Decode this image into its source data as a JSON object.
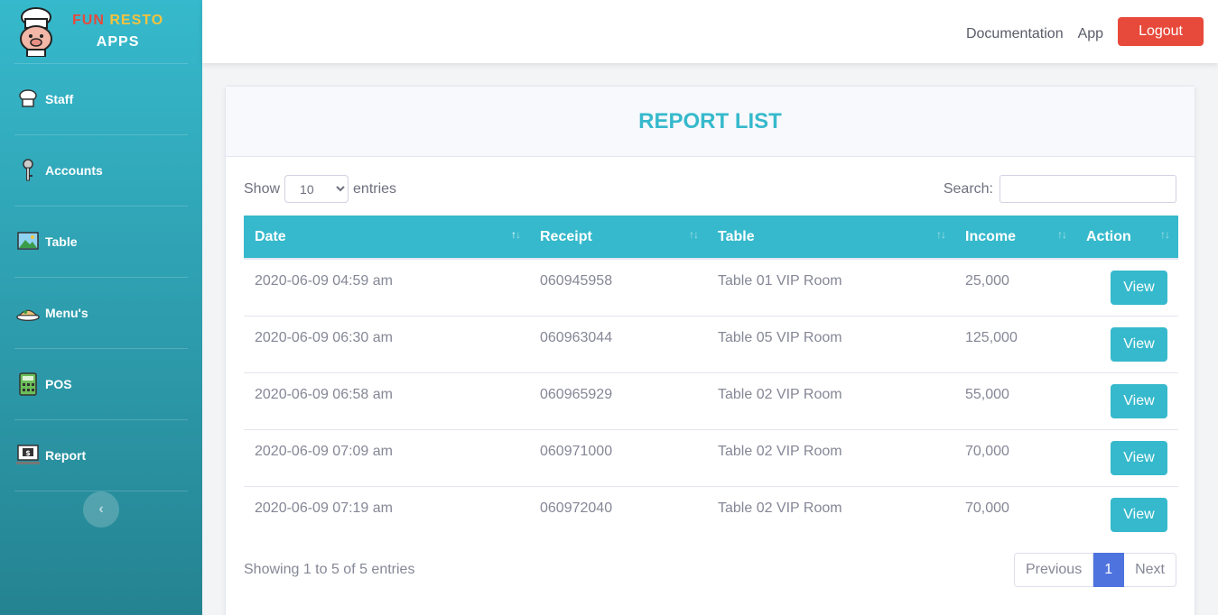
{
  "brand": {
    "fun": "FUN",
    "resto": "RESTO",
    "apps": "APPS"
  },
  "sidebar": {
    "items": [
      {
        "label": "Staff",
        "icon": "chef-hat-icon"
      },
      {
        "label": "Accounts",
        "icon": "key-icon"
      },
      {
        "label": "Table",
        "icon": "picture-icon"
      },
      {
        "label": "Menu's",
        "icon": "food-dish-icon"
      },
      {
        "label": "POS",
        "icon": "calculator-icon"
      },
      {
        "label": "Report",
        "icon": "money-monitor-icon"
      }
    ],
    "toggle_glyph": "‹"
  },
  "topbar": {
    "documentation": "Documentation",
    "app": "App",
    "logout": "Logout"
  },
  "card": {
    "title": "REPORT LIST"
  },
  "controls": {
    "show": "Show",
    "entries": "entries",
    "length_value": "10",
    "search_label": "Search:"
  },
  "table": {
    "headers": [
      "Date",
      "Receipt",
      "Table",
      "Income",
      "Action"
    ],
    "rows": [
      {
        "date": "2020-06-09 04:59 am",
        "receipt": "060945958",
        "table": "Table 01 VIP Room",
        "income": "25,000",
        "action": "View"
      },
      {
        "date": "2020-06-09 06:30 am",
        "receipt": "060963044",
        "table": "Table 05 VIP Room",
        "income": "125,000",
        "action": "View"
      },
      {
        "date": "2020-06-09 06:58 am",
        "receipt": "060965929",
        "table": "Table 02 VIP Room",
        "income": "55,000",
        "action": "View"
      },
      {
        "date": "2020-06-09 07:09 am",
        "receipt": "060971000",
        "table": "Table 02 VIP Room",
        "income": "70,000",
        "action": "View"
      },
      {
        "date": "2020-06-09 07:19 am",
        "receipt": "060972040",
        "table": "Table 02 VIP Room",
        "income": "70,000",
        "action": "View"
      }
    ]
  },
  "footer": {
    "info": "Showing 1 to 5 of 5 entries",
    "previous": "Previous",
    "page": "1",
    "next": "Next"
  },
  "colors": {
    "accent": "#36b9cc",
    "danger": "#e74a3b",
    "primary": "#4e73df",
    "warning": "#f6c23e"
  }
}
